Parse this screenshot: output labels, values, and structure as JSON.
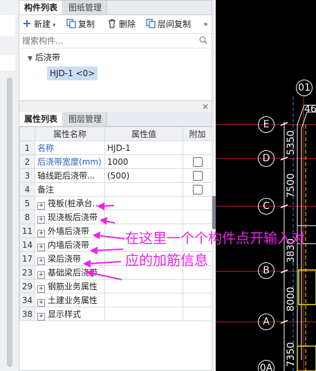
{
  "component_panel": {
    "tabs": [
      "构件列表",
      "图纸管理"
    ],
    "toolbar": {
      "new_label": "新建",
      "copy_label": "复制",
      "delete_label": "删除",
      "floor_copy_label": "层间复制",
      "more_label": "»"
    },
    "search_placeholder": "搜索构件...",
    "tree": {
      "group_label": "后浇带",
      "selected_item": "HJD-1 <0>"
    }
  },
  "property_panel": {
    "tabs": [
      "属性列表",
      "图层管理"
    ],
    "close_label": "×",
    "columns": [
      "属性名称",
      "属性值",
      "附加"
    ],
    "rows": [
      {
        "num": "1",
        "name": "名称",
        "value": "HJD-1",
        "checkbox": false,
        "blue": true
      },
      {
        "num": "2",
        "name": "后浇带宽度(mm)",
        "value": "1000",
        "checkbox": true,
        "blue": true
      },
      {
        "num": "3",
        "name": "轴线距后浇带...",
        "value": "(500)",
        "checkbox": true,
        "blue": false
      },
      {
        "num": "4",
        "name": "备注",
        "value": "",
        "checkbox": true,
        "blue": false
      },
      {
        "num": "5",
        "name": "筏板(桩承台...",
        "value": "",
        "expand": true
      },
      {
        "num": "8",
        "name": "现浇板后浇带",
        "value": "",
        "expand": true
      },
      {
        "num": "11",
        "name": "外墙后浇带",
        "value": "",
        "expand": true
      },
      {
        "num": "14",
        "name": "内墙后浇带",
        "value": "",
        "expand": true
      },
      {
        "num": "17",
        "name": "梁后浇带",
        "value": "",
        "expand": true
      },
      {
        "num": "23",
        "name": "基础梁后浇带",
        "value": "",
        "expand": true
      },
      {
        "num": "29",
        "name": "钢筋业务属性",
        "value": "",
        "expand": true
      },
      {
        "num": "34",
        "name": "土建业务属性",
        "value": "",
        "expand": true
      },
      {
        "num": "38",
        "name": "显示样式",
        "value": "",
        "expand": true
      }
    ]
  },
  "annotation": {
    "text": "在这里一个个构件点开输入对应的加筋信息",
    "color": "#ee22ee"
  },
  "cad": {
    "axis_bubbles": [
      "01",
      "E",
      "D",
      "C",
      "B",
      "A",
      "0A"
    ],
    "top_number": "46",
    "dimensions": [
      "5350",
      "7500",
      "3830",
      "8000",
      "7350"
    ]
  }
}
